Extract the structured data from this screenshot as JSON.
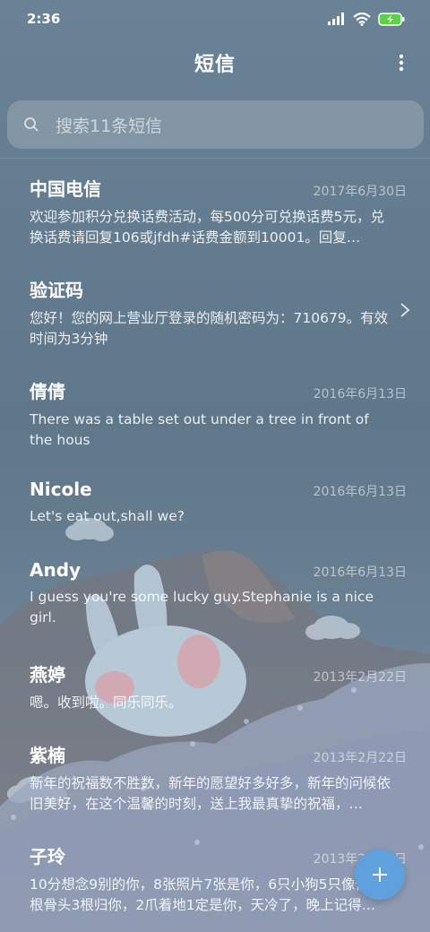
{
  "status_bar": {
    "time": "2:36"
  },
  "header": {
    "title": "短信"
  },
  "search": {
    "placeholder": "搜索11条短信"
  },
  "messages": [
    {
      "name": "中国电信",
      "date": "2017年6月30日",
      "preview": "欢迎参加积分兑换话费活动，每500分可兑换话费5元，兑换话费请回复106或jfdh#话费金额到10001。回复…"
    },
    {
      "name": "验证码",
      "date": "",
      "preview": "您好！您的网上营业厅登录的随机密码为：710679。有效时间为3分钟"
    },
    {
      "name": "倩倩",
      "date": "2016年6月13日",
      "preview": "There was a table set out under a tree in front of the hous"
    },
    {
      "name": "Nicole",
      "date": "2016年6月13日",
      "preview": "Let's eat out,shall we?"
    },
    {
      "name": "Andy",
      "date": "2016年6月13日",
      "preview": "I guess you're some lucky guy.Stephanie is a nice girl."
    },
    {
      "name": "燕婷",
      "date": "2013年2月22日",
      "preview": "嗯。收到啦。同乐同乐。"
    },
    {
      "name": "紫楠",
      "date": "2013年2月22日",
      "preview": "新年的祝福数不胜数，新年的愿望好多好多，新年的问候依旧美好，在这个温馨的时刻，送上我最真挚的祝福，…"
    },
    {
      "name": "子玲",
      "date": "2013年2月22日",
      "preview": "10分想念9别的你，8张照片7张是你，6只小狗5只像你，4根骨头3根归你，2爪着地1定是你，天冷了，晚上记得…"
    }
  ],
  "icons": {
    "signal": "signal-icon",
    "wifi": "wifi-icon",
    "battery": "battery-charging-icon",
    "more": "more-vertical-icon",
    "search": "search-icon",
    "chevron": "chevron-right-icon",
    "compose": "plus-icon"
  },
  "colors": {
    "accent": "#5ea1dd",
    "battery": "#5ed04a"
  }
}
